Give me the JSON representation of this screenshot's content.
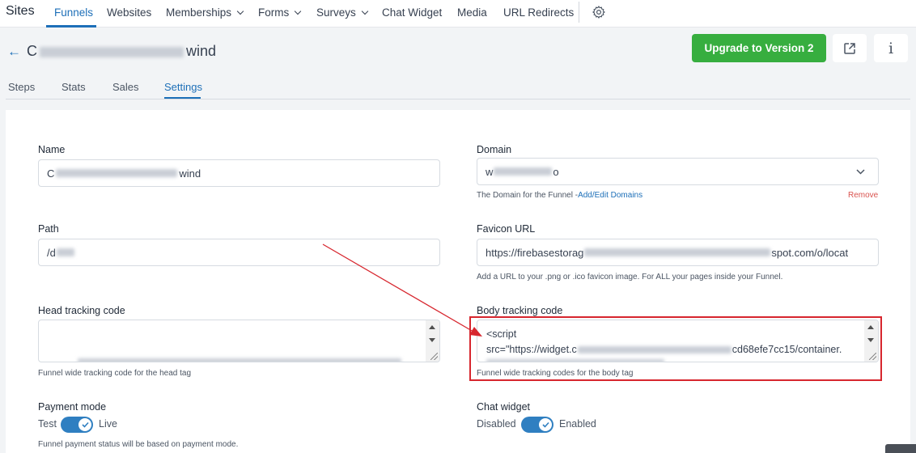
{
  "nav": {
    "brand": "Sites",
    "items": [
      {
        "label": "Funnels",
        "active": true
      },
      {
        "label": "Websites"
      },
      {
        "label": "Memberships",
        "dropdown": true
      },
      {
        "label": "Forms",
        "dropdown": true
      },
      {
        "label": "Surveys",
        "dropdown": true
      },
      {
        "label": "Chat Widget"
      },
      {
        "label": "Media"
      },
      {
        "label": "URL Redirects"
      }
    ],
    "settings_icon": "gear-icon"
  },
  "header": {
    "back_icon": "arrow-left-icon",
    "title_start": "C",
    "title_end": "wind",
    "upgrade_label": "Upgrade to Version 2",
    "external_icon": "external-link-icon",
    "info_label": "i"
  },
  "tabs": [
    {
      "label": "Steps"
    },
    {
      "label": "Stats"
    },
    {
      "label": "Sales"
    },
    {
      "label": "Settings",
      "active": true
    }
  ],
  "form": {
    "name": {
      "label": "Name",
      "value_start": "C",
      "value_end": "wind"
    },
    "domain": {
      "label": "Domain",
      "value_start": "w",
      "value_end": "o",
      "help_text": "The Domain for the Funnel -",
      "help_link": "Add/Edit Domains",
      "remove_label": "Remove"
    },
    "path": {
      "label": "Path",
      "value_start": "/d"
    },
    "favicon": {
      "label": "Favicon URL",
      "value_start": "https://firebasestorag",
      "value_end": "spot.com/o/locat",
      "help_text": "Add a URL to your .png or .ico favicon image. For ALL your pages inside your Funnel."
    },
    "head_tracking": {
      "label": "Head tracking code",
      "help_text": "Funnel wide tracking code for the head tag"
    },
    "body_tracking": {
      "label": "Body tracking code",
      "line1": "<script",
      "line2_start": "src=\"https://widget.c",
      "line2_end": "cd68efe7cc15/container.",
      "help_text": "Funnel wide tracking codes for the body tag"
    },
    "payment_mode": {
      "label": "Payment mode",
      "off_label": "Test",
      "on_label": "Live",
      "enabled": true,
      "help_text": "Funnel payment status will be based on payment mode."
    },
    "chat_widget": {
      "label": "Chat widget",
      "off_label": "Disabled",
      "on_label": "Enabled",
      "enabled": true
    }
  },
  "colors": {
    "accent": "#1d6fb8",
    "upgrade_green": "#37ae3f",
    "annotation_red": "#d7262e",
    "toggle_on": "#2f7fc1"
  }
}
